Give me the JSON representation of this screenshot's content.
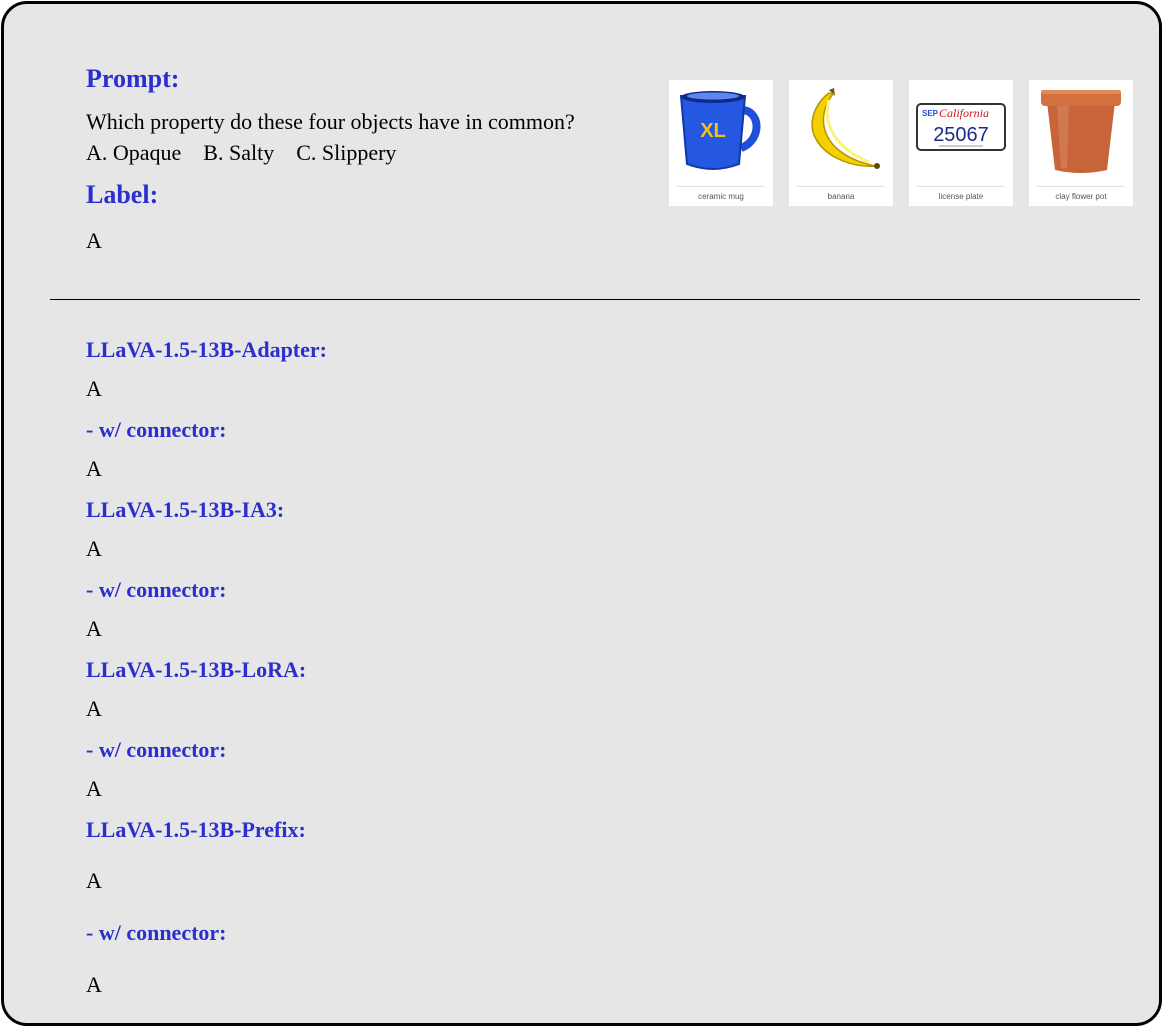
{
  "prompt": {
    "heading": "Prompt:",
    "question": "Which property do these four objects have in common?",
    "options": "A. Opaque    B. Salty    C. Slippery"
  },
  "label": {
    "heading": "Label:",
    "value": "A"
  },
  "images": [
    {
      "caption": "ceramic mug",
      "icon": "ceramic-mug-icon",
      "text": "XL"
    },
    {
      "caption": "banana",
      "icon": "banana-icon"
    },
    {
      "caption": "license plate",
      "icon": "license-plate-icon",
      "text": {
        "prefix": "SEP",
        "state": "California",
        "number": "25067"
      }
    },
    {
      "caption": "clay flower pot",
      "icon": "clay-flower-pot-icon"
    }
  ],
  "results": [
    {
      "model": "LLaVA-1.5-13B-Adapter:",
      "answer": "A",
      "connector_label": "- w/ connector:",
      "connector_answer": "A"
    },
    {
      "model": "LLaVA-1.5-13B-IA3:",
      "answer": "A",
      "connector_label": "- w/ connector:",
      "connector_answer": "A"
    },
    {
      "model": "LLaVA-1.5-13B-LoRA:",
      "answer": "A",
      "connector_label": "- w/ connector:",
      "connector_answer": "A"
    },
    {
      "model": "LLaVA-1.5-13B-Prefix:",
      "answer": "A",
      "connector_label": "- w/ connector:",
      "connector_answer": "A"
    }
  ],
  "colors": {
    "heading": "#2b2fcf",
    "card_background": "#e6e6e6",
    "border": "#000000"
  }
}
